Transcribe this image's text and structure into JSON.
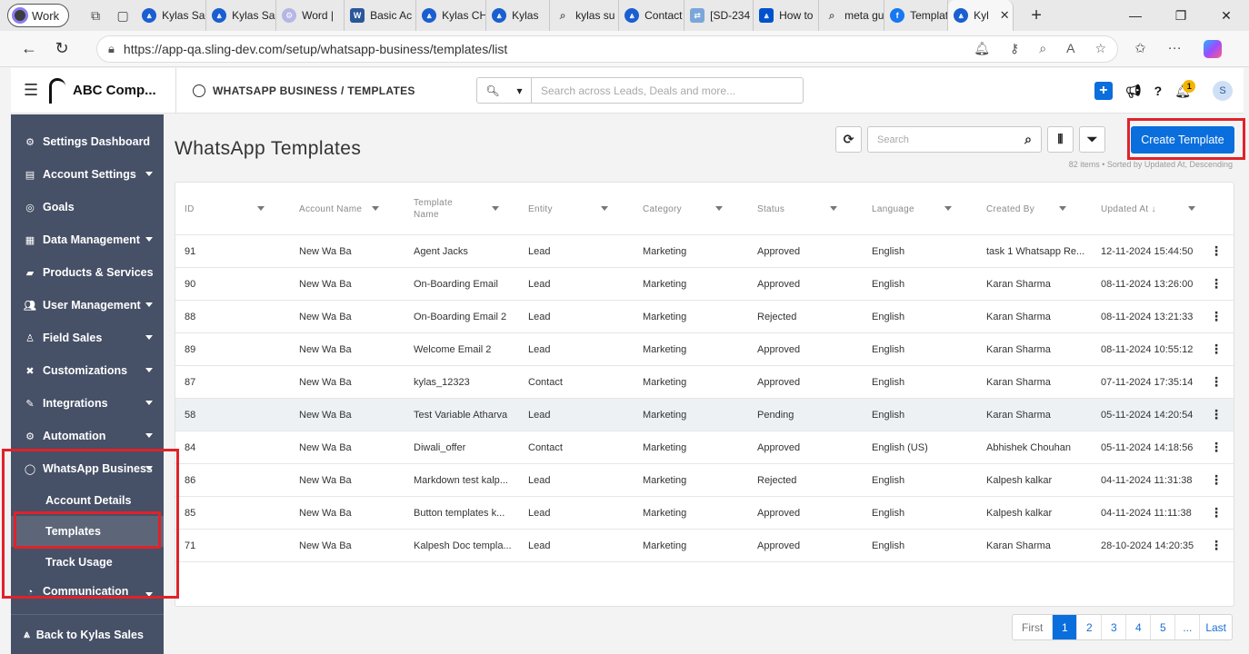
{
  "browser": {
    "profile": "Work",
    "tabs": [
      {
        "label": "Kylas Sa",
        "icon": "kylas"
      },
      {
        "label": "Kylas Sa",
        "icon": "kylas"
      },
      {
        "label": "Word |",
        "icon": "gear"
      },
      {
        "label": "Basic Ac",
        "icon": "word"
      },
      {
        "label": "Kylas CH",
        "icon": "kylas"
      },
      {
        "label": "Kylas",
        "icon": "kylas"
      },
      {
        "label": "kylas su",
        "icon": "search"
      },
      {
        "label": "Contact",
        "icon": "kylas"
      },
      {
        "label": "[SD-234",
        "icon": "jira"
      },
      {
        "label": "How to",
        "icon": "blue"
      },
      {
        "label": "meta gu",
        "icon": "search"
      },
      {
        "label": "Templat",
        "icon": "fb"
      },
      {
        "label": "Kyl",
        "icon": "kylas",
        "active": true
      }
    ],
    "url": "https://app-qa.sling-dev.com/setup/whatsapp-business/templates/list"
  },
  "header": {
    "company": "ABC Comp...",
    "breadcrumb": "WHATSAPP BUSINESS / TEMPLATES",
    "search_placeholder": "Search across Leads, Deals and more...",
    "notification_count": "1",
    "avatar_initial": "S"
  },
  "sidebar": {
    "items": [
      {
        "label": "Settings Dashboard",
        "icon": "gear-icon",
        "caret": false
      },
      {
        "label": "Account Settings",
        "icon": "account-icon",
        "caret": true
      },
      {
        "label": "Goals",
        "icon": "goals-icon",
        "caret": false
      },
      {
        "label": "Data Management",
        "icon": "table-icon",
        "caret": true
      },
      {
        "label": "Products & Services",
        "icon": "box-icon",
        "caret": false
      },
      {
        "label": "User Management",
        "icon": "users-icon",
        "caret": true
      },
      {
        "label": "Field Sales",
        "icon": "person-icon",
        "caret": true
      },
      {
        "label": "Customizations",
        "icon": "tools-icon",
        "caret": true
      },
      {
        "label": "Integrations",
        "icon": "plug-icon",
        "caret": true
      },
      {
        "label": "Automation",
        "icon": "cogs-icon",
        "caret": true
      },
      {
        "label": "WhatsApp Business",
        "icon": "whatsapp-icon",
        "caret": true
      }
    ],
    "sub_items": [
      {
        "label": "Account Details",
        "active": false
      },
      {
        "label": "Templates",
        "active": true
      },
      {
        "label": "Track Usage",
        "active": false
      }
    ],
    "partial_item": "Communication",
    "footer": "Back to Kylas Sales"
  },
  "main": {
    "title": "WhatsApp Templates",
    "search_placeholder": "Search",
    "create_label": "Create Template",
    "sort_info": "82 items • Sorted by Updated At, Descending",
    "columns": [
      "ID",
      "Account Name",
      "Template Name",
      "Entity",
      "Category",
      "Status",
      "Language",
      "Created By",
      "Updated At"
    ],
    "rows": [
      [
        "91",
        "New Wa Ba",
        "Agent Jacks",
        "Lead",
        "Marketing",
        "Approved",
        "English",
        "task 1 Whatsapp Re...",
        "12-11-2024 15:44:50"
      ],
      [
        "90",
        "New Wa Ba",
        "On-Boarding Email",
        "Lead",
        "Marketing",
        "Approved",
        "English",
        "Karan Sharma",
        "08-11-2024 13:26:00"
      ],
      [
        "88",
        "New Wa Ba",
        "On-Boarding Email 2",
        "Lead",
        "Marketing",
        "Rejected",
        "English",
        "Karan Sharma",
        "08-11-2024 13:21:33"
      ],
      [
        "89",
        "New Wa Ba",
        "Welcome Email 2",
        "Lead",
        "Marketing",
        "Approved",
        "English",
        "Karan Sharma",
        "08-11-2024 10:55:12"
      ],
      [
        "87",
        "New Wa Ba",
        "kylas_12323",
        "Contact",
        "Marketing",
        "Approved",
        "English",
        "Karan Sharma",
        "07-11-2024 17:35:14"
      ],
      [
        "58",
        "New Wa Ba",
        "Test Variable Atharva",
        "Lead",
        "Marketing",
        "Pending",
        "English",
        "Karan Sharma",
        "05-11-2024 14:20:54"
      ],
      [
        "84",
        "New Wa Ba",
        "Diwali_offer",
        "Contact",
        "Marketing",
        "Approved",
        "English (US)",
        "Abhishek Chouhan",
        "05-11-2024 14:18:56"
      ],
      [
        "86",
        "New Wa Ba",
        "Markdown test kalp...",
        "Lead",
        "Marketing",
        "Rejected",
        "English",
        "Kalpesh kalkar",
        "04-11-2024 11:31:38"
      ],
      [
        "85",
        "New Wa Ba",
        "Button templates k...",
        "Lead",
        "Marketing",
        "Approved",
        "English",
        "Kalpesh kalkar",
        "04-11-2024 11:11:38"
      ],
      [
        "71",
        "New Wa Ba",
        "Kalpesh Doc templa...",
        "Lead",
        "Marketing",
        "Approved",
        "English",
        "Karan Sharma",
        "28-10-2024 14:20:35"
      ]
    ],
    "highlight_row": 5,
    "pagination": [
      "First",
      "1",
      "2",
      "3",
      "4",
      "5",
      "...",
      "Last"
    ],
    "active_page": "1"
  }
}
